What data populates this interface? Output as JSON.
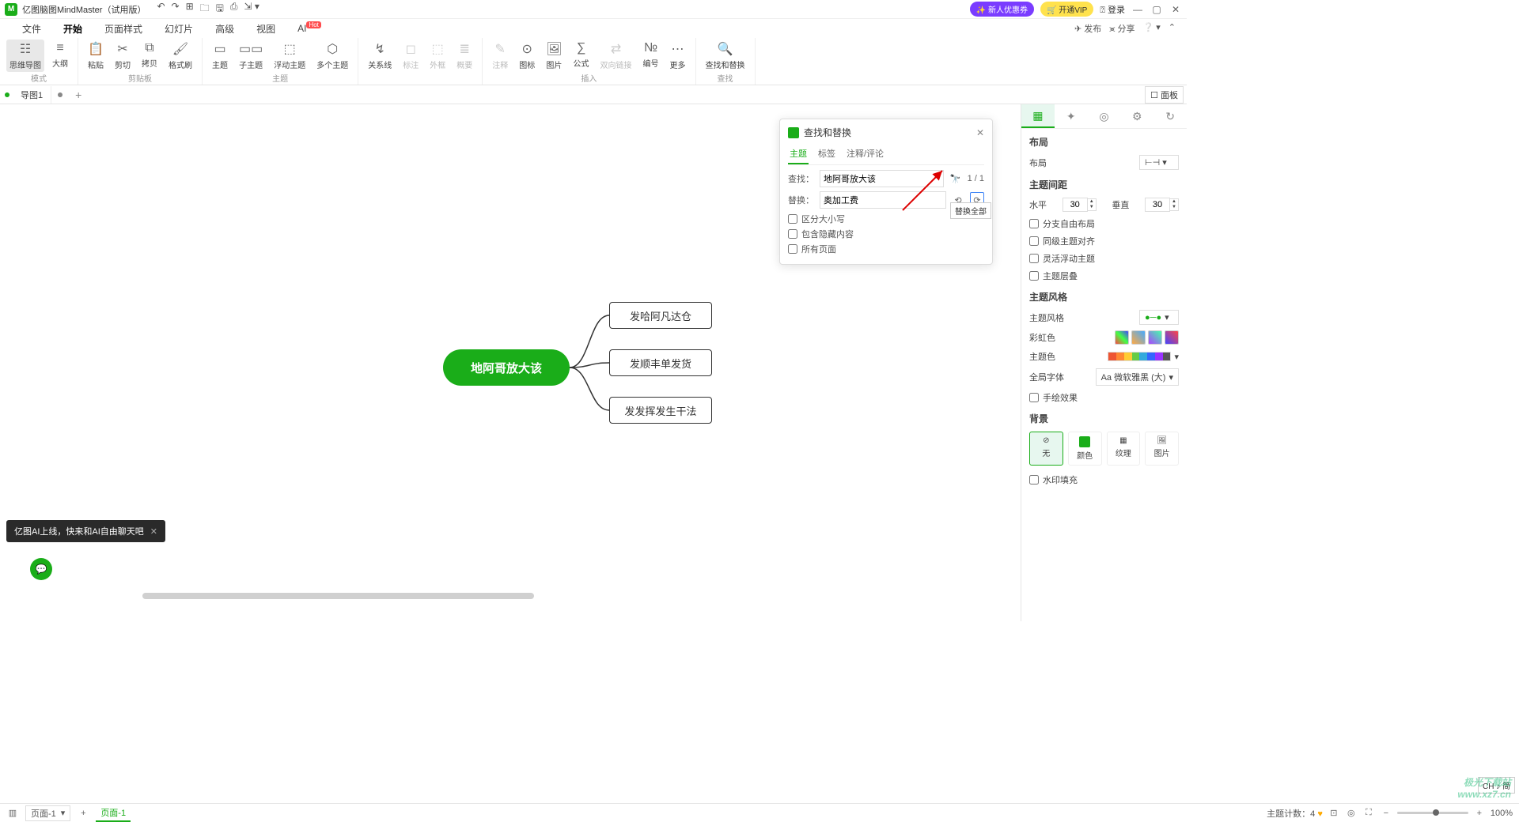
{
  "titlebar": {
    "app_title": "亿图脑图MindMaster（试用版）",
    "badges": {
      "new_user": "✨ 新人优惠券",
      "vip": "🛒 开通VIP"
    },
    "login": "⍰ 登录"
  },
  "menubar": {
    "items": [
      "文件",
      "开始",
      "页面样式",
      "幻灯片",
      "高级",
      "视图",
      "AI"
    ],
    "active_index": 1,
    "hot_index": 6,
    "right": {
      "publish": "✈ 发布",
      "share": "⪤ 分享"
    }
  },
  "ribbon": {
    "groups": [
      {
        "label": "模式",
        "items": [
          {
            "icon": "☷",
            "text": "思维导图"
          },
          {
            "icon": "≡",
            "text": "大纲"
          }
        ]
      },
      {
        "label": "剪贴板",
        "items": [
          {
            "icon": "📋",
            "text": "粘贴"
          },
          {
            "icon": "✂",
            "text": "剪切",
            "small": true
          },
          {
            "icon": "⧉",
            "text": "拷贝",
            "small": true
          },
          {
            "icon": "🖌",
            "text": "格式刷"
          }
        ]
      },
      {
        "label": "主题",
        "items": [
          {
            "icon": "▭",
            "text": "主题"
          },
          {
            "icon": "▭▭",
            "text": "子主题"
          },
          {
            "icon": "⬚",
            "text": "浮动主题"
          },
          {
            "icon": "⬡",
            "text": "多个主题"
          }
        ]
      },
      {
        "label": "",
        "items": [
          {
            "icon": "↯",
            "text": "关系线"
          },
          {
            "icon": "◻",
            "text": "标注",
            "disabled": true
          },
          {
            "icon": "⬚",
            "text": "外框",
            "disabled": true
          },
          {
            "icon": "≣",
            "text": "概要",
            "disabled": true
          }
        ]
      },
      {
        "label": "插入",
        "items": [
          {
            "icon": "✎",
            "text": "注释",
            "disabled": true
          },
          {
            "icon": "⊙",
            "text": "图标"
          },
          {
            "icon": "🖼",
            "text": "图片"
          },
          {
            "icon": "∑",
            "text": "公式"
          },
          {
            "icon": "⇄",
            "text": "双向链接",
            "disabled": true
          },
          {
            "icon": "№",
            "text": "编号"
          },
          {
            "icon": "⋯",
            "text": "更多"
          }
        ]
      },
      {
        "label": "查找",
        "items": [
          {
            "icon": "🔍",
            "text": "查找和替换"
          }
        ]
      }
    ]
  },
  "tabs": {
    "doc": "导图1",
    "panel_btn": "☐ 面板"
  },
  "mindmap": {
    "central": "地阿哥放大该",
    "children": [
      "发哈阿凡达仓",
      "发顺丰单发货",
      "发发挥发生干法"
    ]
  },
  "find": {
    "title": "查找和替换",
    "tabs": [
      "主题",
      "标签",
      "注释/评论"
    ],
    "find_label": "查找：",
    "find_value": "地阿哥放大该",
    "replace_label": "替换：",
    "replace_value": "奥加工费",
    "count": "1 / 1",
    "opts": [
      "区分大小写",
      "包含隐藏内容",
      "所有页面"
    ],
    "tooltip": "替换全部"
  },
  "right_panel": {
    "section_layout": "布局",
    "layout_label": "布局",
    "spacing": "主题间距",
    "h_label": "水平",
    "h_val": "30",
    "v_label": "垂直",
    "v_val": "30",
    "chk_free": "分支自由布局",
    "chk_align": "同级主题对齐",
    "chk_float": "灵活浮动主题",
    "chk_layer": "主题层叠",
    "section_style": "主题风格",
    "style_label": "主题风格",
    "rainbow": "彩虹色",
    "theme_color": "主题色",
    "font": "全局字体",
    "font_val": "Aa 微软雅黑 (大)",
    "hand": "手绘效果",
    "section_bg": "背景",
    "bg_opts": [
      "无",
      "颜色",
      "纹理",
      "图片"
    ],
    "watermark_fill": "水印填充",
    "ime": "CH ♪ 简"
  },
  "toast": {
    "text": "亿图AI上线，快来和AI自由聊天吧"
  },
  "status": {
    "page_sel": "页面-1",
    "tab": "页面-1",
    "topic_count": "主题计数：4",
    "zoom": "100%",
    "watermark": "极光下载站\nwww.xz7.cn"
  }
}
